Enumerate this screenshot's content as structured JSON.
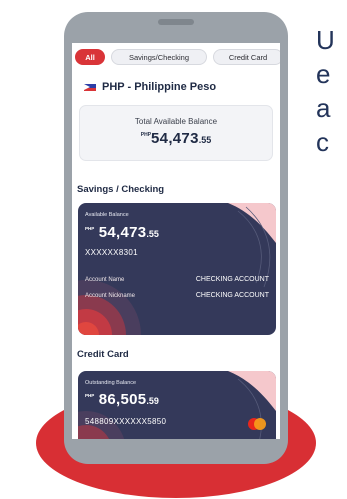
{
  "side_text": [
    "U",
    "e",
    "a",
    "c"
  ],
  "tabs": [
    {
      "label": "All",
      "active": true
    },
    {
      "label": "Savings/Checking",
      "active": false
    },
    {
      "label": "Credit Card",
      "active": false
    }
  ],
  "currency": {
    "flag_icon": "philippines-flag-icon",
    "label": "PHP - Philippine Peso"
  },
  "total": {
    "label": "Total Available Balance",
    "currency": "PHP",
    "amount_whole": "54,473",
    "amount_decimal": ".55"
  },
  "savings_section": {
    "title": "Savings / Checking",
    "card": {
      "balance_label": "Available Balance",
      "currency": "PHP",
      "amount_whole": "54,473",
      "amount_decimal": ".55",
      "account_number": "XXXXXX8301",
      "rows": [
        {
          "label": "Account Name",
          "value": "CHECKING ACCOUNT"
        },
        {
          "label": "Account Nickname",
          "value": "CHECKING ACCOUNT"
        }
      ],
      "accent_colors": [
        "#34395a",
        "#d93438",
        "#f5c8cc"
      ]
    }
  },
  "credit_section": {
    "title": "Credit Card",
    "card": {
      "balance_label": "Outstanding Balance",
      "currency": "PHP",
      "amount_whole": "86,505",
      "amount_decimal": ".59",
      "card_number": "548809XXXXXX5850",
      "brand_icon": "mastercard-icon"
    }
  },
  "colors": {
    "brand_red": "#d93438",
    "card_navy": "#34395a",
    "phone_gray": "#9ba2a9",
    "text_navy": "#1f2a44"
  }
}
